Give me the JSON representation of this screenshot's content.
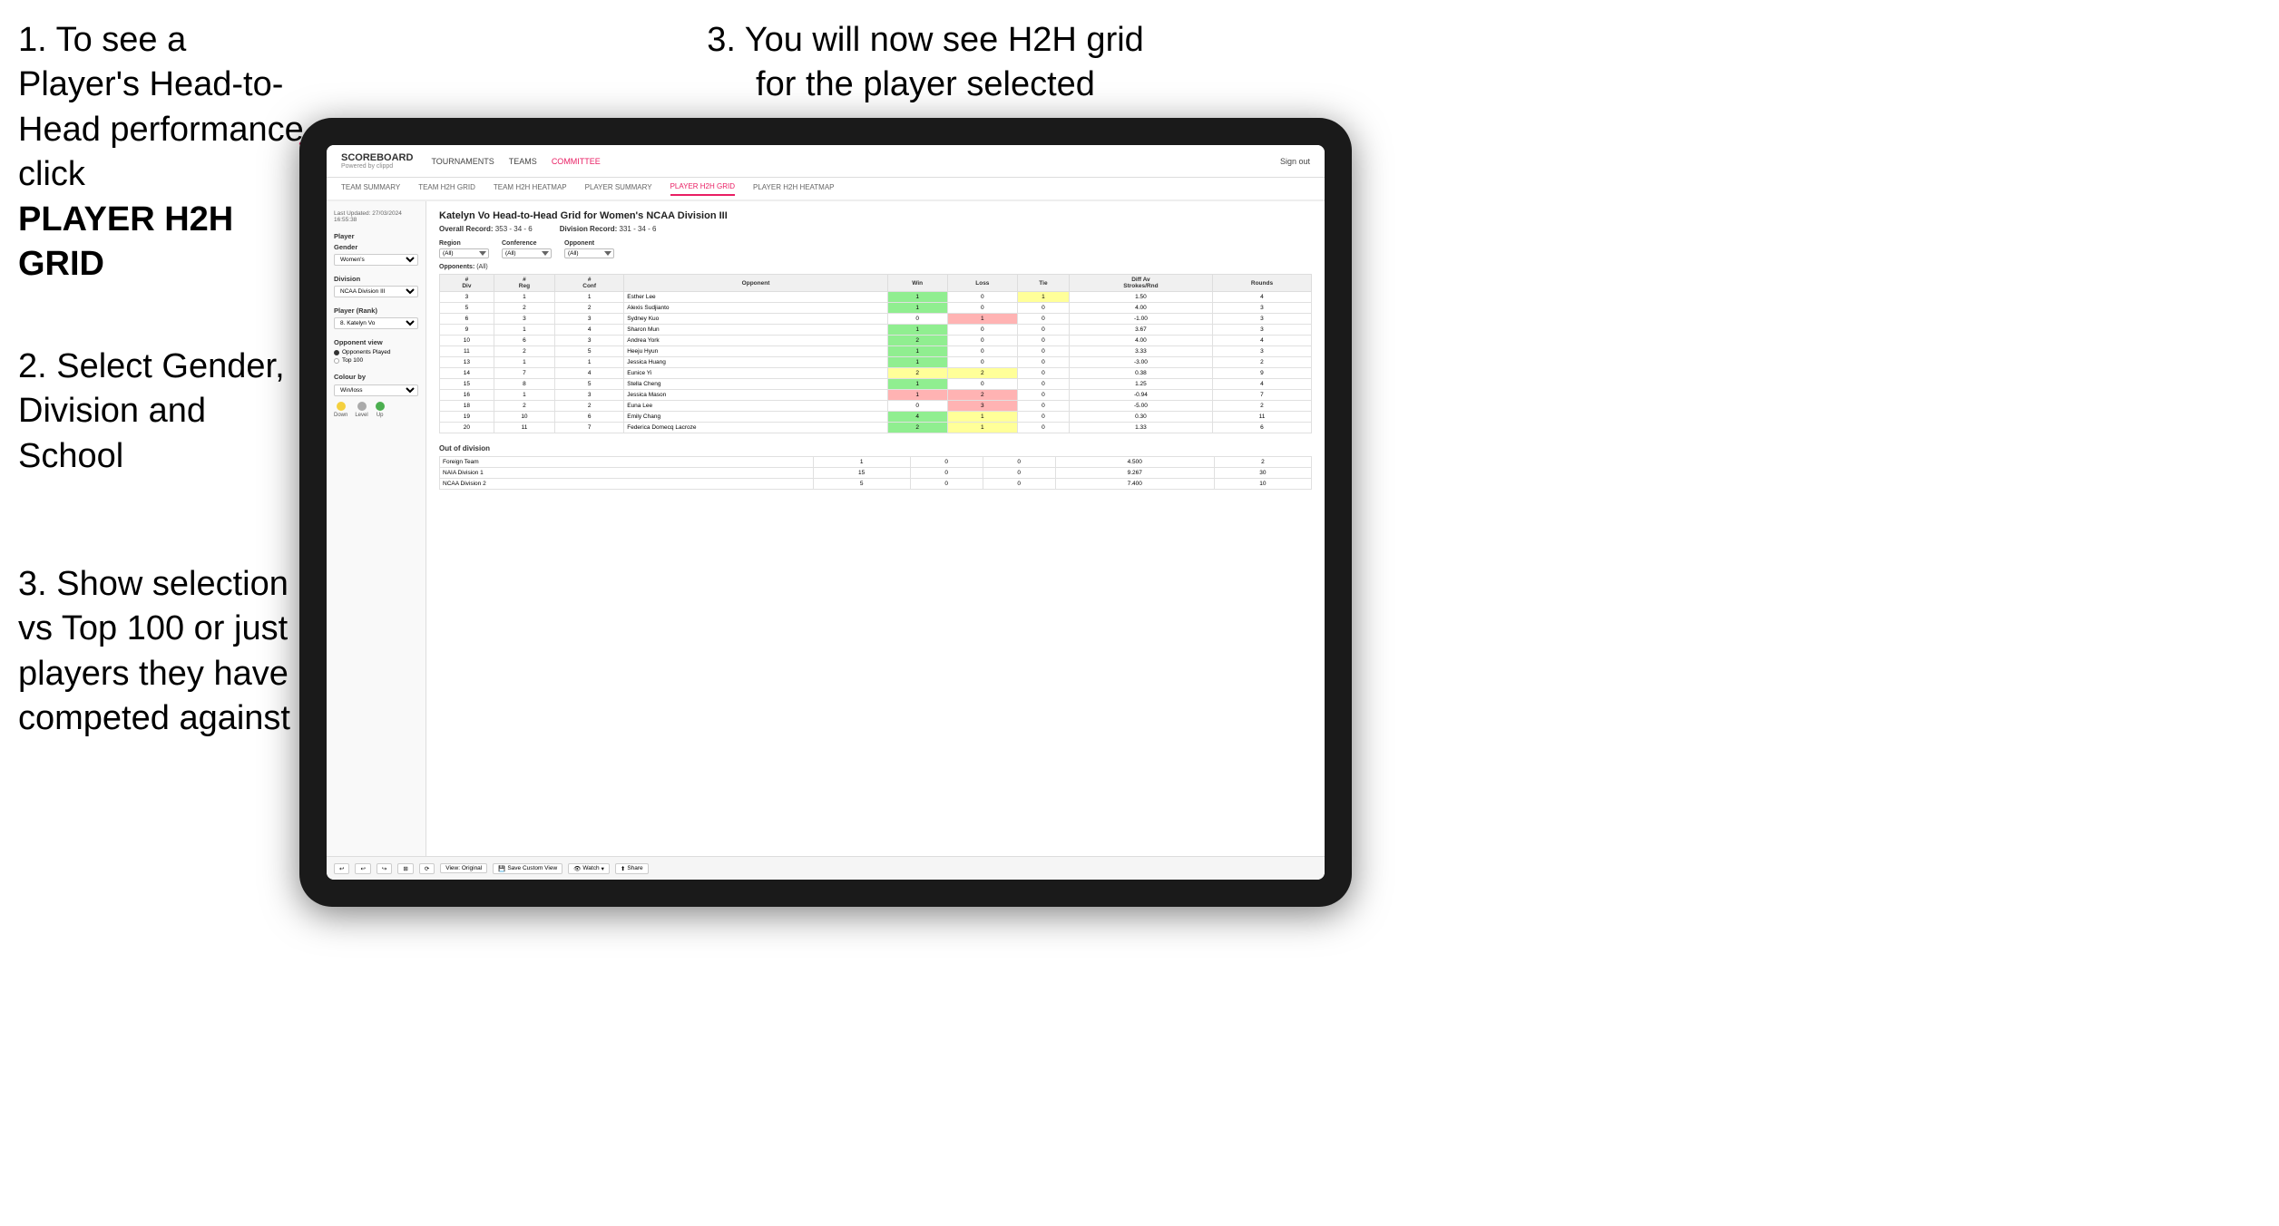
{
  "instructions": {
    "step1": "1. To see a Player's Head-to-Head performance click",
    "step1_bold": "PLAYER H2H GRID",
    "step2": "2. Select Gender, Division and School",
    "step3_left": "3. Show selection vs Top 100 or just players they have competed against",
    "step3_right": "3. You will now see H2H grid for the player selected"
  },
  "nav": {
    "logo": "SCOREBOARD",
    "logo_sub": "Powered by clippd",
    "links": [
      "TOURNAMENTS",
      "TEAMS",
      "COMMITTEE"
    ],
    "sign_out": "Sign out",
    "sub_links": [
      "TEAM SUMMARY",
      "TEAM H2H GRID",
      "TEAM H2H HEATMAP",
      "PLAYER SUMMARY",
      "PLAYER H2H GRID",
      "PLAYER H2H HEATMAP"
    ],
    "active_sub": "PLAYER H2H GRID"
  },
  "left_panel": {
    "timestamp": "Last Updated: 27/03/2024\n16:55:38",
    "player_label": "Player",
    "gender_label": "Gender",
    "gender_value": "Women's",
    "division_label": "Division",
    "division_value": "NCAA Division III",
    "player_rank_label": "Player (Rank)",
    "player_rank_value": "8. Katelyn Vo",
    "opponent_view_label": "Opponent view",
    "radio1": "Opponents Played",
    "radio2": "Top 100",
    "colour_by_label": "Colour by",
    "colour_by_value": "Win/loss",
    "legend": [
      {
        "color": "#f4d03f",
        "label": "Down"
      },
      {
        "color": "#aaa",
        "label": "Level"
      },
      {
        "color": "#4caf50",
        "label": "Up"
      }
    ]
  },
  "grid": {
    "title": "Katelyn Vo Head-to-Head Grid for Women's NCAA Division III",
    "overall_record_label": "Overall Record:",
    "overall_record": "353 - 34 - 6",
    "division_record_label": "Division Record:",
    "division_record": "331 - 34 - 6",
    "region_label": "Region",
    "conference_label": "Conference",
    "opponent_label": "Opponent",
    "opponents_label": "Opponents:",
    "region_filter": "(All)",
    "conference_filter": "(All)",
    "opponent_filter": "(All)",
    "col_headers": [
      "#\nDiv",
      "#\nReg",
      "#\nConf",
      "Opponent",
      "Win",
      "Loss",
      "Tie",
      "Diff Av\nStrokes/Rnd",
      "Rounds"
    ],
    "rows": [
      {
        "div": 3,
        "reg": 1,
        "conf": 1,
        "opponent": "Esther Lee",
        "win": 1,
        "loss": 0,
        "tie": 1,
        "diff": "1.50",
        "rounds": 4,
        "win_color": "green",
        "loss_color": "white",
        "tie_color": "yellow"
      },
      {
        "div": 5,
        "reg": 2,
        "conf": 2,
        "opponent": "Alexis Sudjianto",
        "win": 1,
        "loss": 0,
        "tie": 0,
        "diff": "4.00",
        "rounds": 3,
        "win_color": "green",
        "loss_color": "white",
        "tie_color": "white"
      },
      {
        "div": 6,
        "reg": 3,
        "conf": 3,
        "opponent": "Sydney Kuo",
        "win": 0,
        "loss": 1,
        "tie": 0,
        "diff": "-1.00",
        "rounds": 3,
        "win_color": "white",
        "loss_color": "red",
        "tie_color": "white"
      },
      {
        "div": 9,
        "reg": 1,
        "conf": 4,
        "opponent": "Sharon Mun",
        "win": 1,
        "loss": 0,
        "tie": 0,
        "diff": "3.67",
        "rounds": 3,
        "win_color": "green",
        "loss_color": "white",
        "tie_color": "white"
      },
      {
        "div": 10,
        "reg": 6,
        "conf": 3,
        "opponent": "Andrea York",
        "win": 2,
        "loss": 0,
        "tie": 0,
        "diff": "4.00",
        "rounds": 4,
        "win_color": "green",
        "loss_color": "white",
        "tie_color": "white"
      },
      {
        "div": 11,
        "reg": 2,
        "conf": 5,
        "opponent": "Heeju Hyun",
        "win": 1,
        "loss": 0,
        "tie": 0,
        "diff": "3.33",
        "rounds": 3,
        "win_color": "green",
        "loss_color": "white",
        "tie_color": "white"
      },
      {
        "div": 13,
        "reg": 1,
        "conf": 1,
        "opponent": "Jessica Huang",
        "win": 1,
        "loss": 0,
        "tie": 0,
        "diff": "-3.00",
        "rounds": 2,
        "win_color": "green",
        "loss_color": "white",
        "tie_color": "white"
      },
      {
        "div": 14,
        "reg": 7,
        "conf": 4,
        "opponent": "Eunice Yi",
        "win": 2,
        "loss": 2,
        "tie": 0,
        "diff": "0.38",
        "rounds": 9,
        "win_color": "yellow",
        "loss_color": "yellow",
        "tie_color": "white"
      },
      {
        "div": 15,
        "reg": 8,
        "conf": 5,
        "opponent": "Stella Cheng",
        "win": 1,
        "loss": 0,
        "tie": 0,
        "diff": "1.25",
        "rounds": 4,
        "win_color": "green",
        "loss_color": "white",
        "tie_color": "white"
      },
      {
        "div": 16,
        "reg": 1,
        "conf": 3,
        "opponent": "Jessica Mason",
        "win": 1,
        "loss": 2,
        "tie": 0,
        "diff": "-0.94",
        "rounds": 7,
        "win_color": "red",
        "loss_color": "red",
        "tie_color": "white"
      },
      {
        "div": 18,
        "reg": 2,
        "conf": 2,
        "opponent": "Euna Lee",
        "win": 0,
        "loss": 3,
        "tie": 0,
        "diff": "-5.00",
        "rounds": 2,
        "win_color": "white",
        "loss_color": "red",
        "tie_color": "white"
      },
      {
        "div": 19,
        "reg": 10,
        "conf": 6,
        "opponent": "Emily Chang",
        "win": 4,
        "loss": 1,
        "tie": 0,
        "diff": "0.30",
        "rounds": 11,
        "win_color": "green",
        "loss_color": "yellow",
        "tie_color": "white"
      },
      {
        "div": 20,
        "reg": 11,
        "conf": 7,
        "opponent": "Federica Domecq Lacroze",
        "win": 2,
        "loss": 1,
        "tie": 0,
        "diff": "1.33",
        "rounds": 6,
        "win_color": "green",
        "loss_color": "yellow",
        "tie_color": "white"
      }
    ],
    "out_division_title": "Out of division",
    "out_div_rows": [
      {
        "opponent": "Foreign Team",
        "win": 1,
        "loss": 0,
        "tie": 0,
        "diff": "4.500",
        "rounds": 2
      },
      {
        "opponent": "NAIA Division 1",
        "win": 15,
        "loss": 0,
        "tie": 0,
        "diff": "9.267",
        "rounds": 30
      },
      {
        "opponent": "NCAA Division 2",
        "win": 5,
        "loss": 0,
        "tie": 0,
        "diff": "7.400",
        "rounds": 10
      }
    ]
  },
  "toolbar": {
    "view_original": "View: Original",
    "save_custom": "Save Custom View",
    "watch": "Watch",
    "share": "Share"
  }
}
